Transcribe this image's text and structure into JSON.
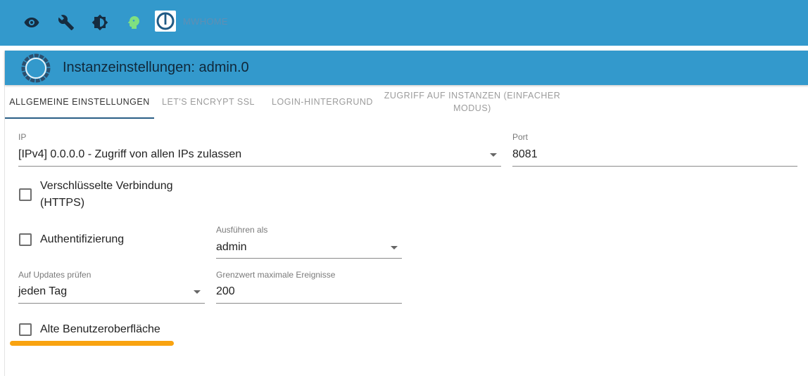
{
  "topbar": {
    "icons": [
      "eye-icon",
      "wrench-icon",
      "brightness-icon",
      "head-icon"
    ],
    "logo": "iobroker-logo",
    "host_name": "MWHOME",
    "colors": {
      "bar": "#3399cc",
      "head_icon": "#7fe07f"
    }
  },
  "dialog": {
    "title": "Instanzeinstellungen: admin.0",
    "icon": "admin-adapter-icon"
  },
  "tabs": [
    {
      "label": "ALLGEMEINE EINSTELLUNGEN",
      "active": true
    },
    {
      "label": "LET'S ENCRYPT SSL",
      "active": false
    },
    {
      "label": "LOGIN-HINTERGRUND",
      "active": false
    },
    {
      "label": "ZUGRIFF AUF INSTANZEN (EINFACHER MODUS)",
      "active": false
    }
  ],
  "form": {
    "ip": {
      "label": "IP",
      "value": "[IPv4] 0.0.0.0 - Zugriff von allen IPs zulassen"
    },
    "port": {
      "label": "Port",
      "value": "8081"
    },
    "https": {
      "label": "Verschlüsselte Verbindung (HTTPS)",
      "checked": false
    },
    "auth": {
      "label": "Authentifizierung",
      "checked": false
    },
    "run_as": {
      "label": "Ausführen als",
      "value": "admin"
    },
    "updates": {
      "label": "Auf Updates prüfen",
      "value": "jeden Tag"
    },
    "max_events": {
      "label": "Grenzwert maximale Ereignisse",
      "value": "200"
    },
    "old_ui": {
      "label": "Alte Benutzeroberfläche",
      "checked": false
    }
  },
  "highlight_color": "#f9a310"
}
